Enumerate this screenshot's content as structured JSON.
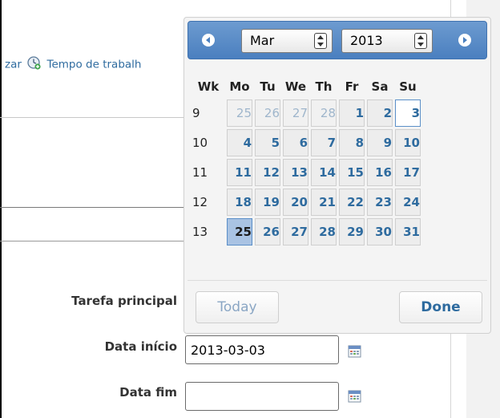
{
  "top_link": {
    "prefix": "zar",
    "label": "Tempo de trabalh"
  },
  "form": {
    "parent_task_label": "Tarefa principal",
    "start_date_label": "Data início",
    "start_date_value": "2013-03-03",
    "end_date_label": "Data fim",
    "end_date_value": ""
  },
  "datepicker": {
    "month": "Mar",
    "year": "2013",
    "weekday_headers": [
      "Wk",
      "Mo",
      "Tu",
      "We",
      "Th",
      "Fr",
      "Sa",
      "Su"
    ],
    "weeks": [
      {
        "wk": "9",
        "days": [
          "25",
          "26",
          "27",
          "28",
          "1",
          "2",
          "3"
        ]
      },
      {
        "wk": "10",
        "days": [
          "4",
          "5",
          "6",
          "7",
          "8",
          "9",
          "10"
        ]
      },
      {
        "wk": "11",
        "days": [
          "11",
          "12",
          "13",
          "14",
          "15",
          "16",
          "17"
        ]
      },
      {
        "wk": "12",
        "days": [
          "18",
          "19",
          "20",
          "21",
          "22",
          "23",
          "24"
        ]
      },
      {
        "wk": "13",
        "days": [
          "25",
          "26",
          "27",
          "28",
          "29",
          "30",
          "31"
        ]
      }
    ],
    "today_button": "Today",
    "done_button": "Done",
    "colors": {
      "header": "#4a7fbf",
      "link": "#2e6b9f",
      "selected": "#a9c3e3"
    }
  }
}
